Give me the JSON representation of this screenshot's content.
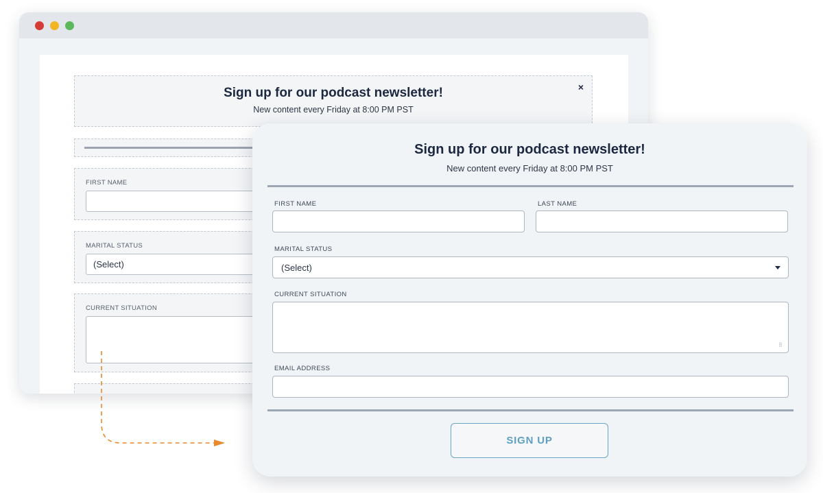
{
  "background_window": {
    "title": "Sign up for our podcast newsletter!",
    "subtitle": "New content every Friday at 8:00 PM PST",
    "close_icon": "×",
    "first_name_label": "FIRST NAME",
    "marital_status_label": "MARITAL STATUS",
    "marital_status_value": "(Select)",
    "current_situation_label": "CURRENT SITUATION"
  },
  "form": {
    "title": "Sign up for our podcast newsletter!",
    "subtitle": "New content every Friday at 8:00 PM PST",
    "first_name_label": "FIRST NAME",
    "last_name_label": "LAST NAME",
    "marital_status_label": "MARITAL STATUS",
    "marital_status_value": "(Select)",
    "current_situation_label": "CURRENT SITUATION",
    "email_label": "EMAIL ADDRESS",
    "submit_label": "SIGN UP"
  },
  "colors": {
    "accent": "#5f9fc1",
    "arrow": "#e8892b",
    "dot_red": "#d63c36",
    "dot_yellow": "#f2b623",
    "dot_green": "#5cb85c"
  }
}
